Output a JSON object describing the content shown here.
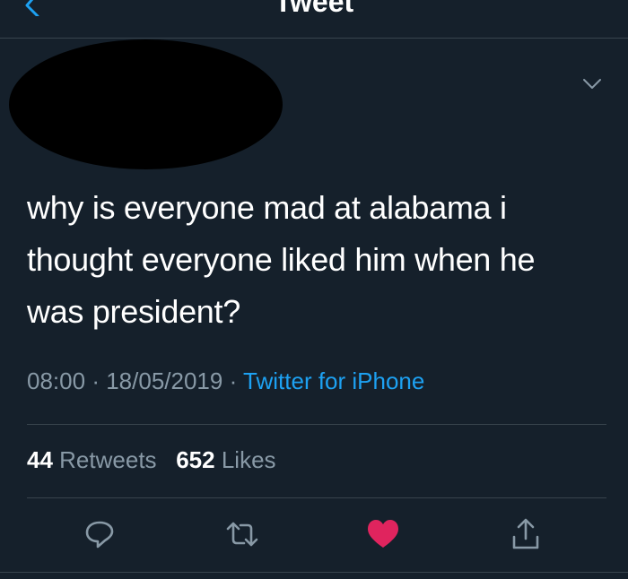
{
  "header": {
    "title": "Tweet"
  },
  "tweet": {
    "text_lines": [
      "why is everyone mad at alabama i",
      "thought everyone liked him when he",
      "was president?"
    ],
    "time": "08:00",
    "separator": "·",
    "date": "18/05/2019",
    "source": "Twitter for iPhone"
  },
  "stats": {
    "retweets_count": "44",
    "retweets_label": "Retweets",
    "likes_count": "652",
    "likes_label": "Likes"
  },
  "icons": {
    "back": "chevron-left-icon",
    "more": "chevron-down-icon",
    "reply": "reply-icon",
    "retweet": "retweet-icon",
    "like": "heart-icon",
    "share": "share-icon"
  },
  "colors": {
    "background": "#15202b",
    "accent": "#1da1f2",
    "muted": "#8899a6",
    "like_active": "#e0245e",
    "divider": "#38444d"
  }
}
